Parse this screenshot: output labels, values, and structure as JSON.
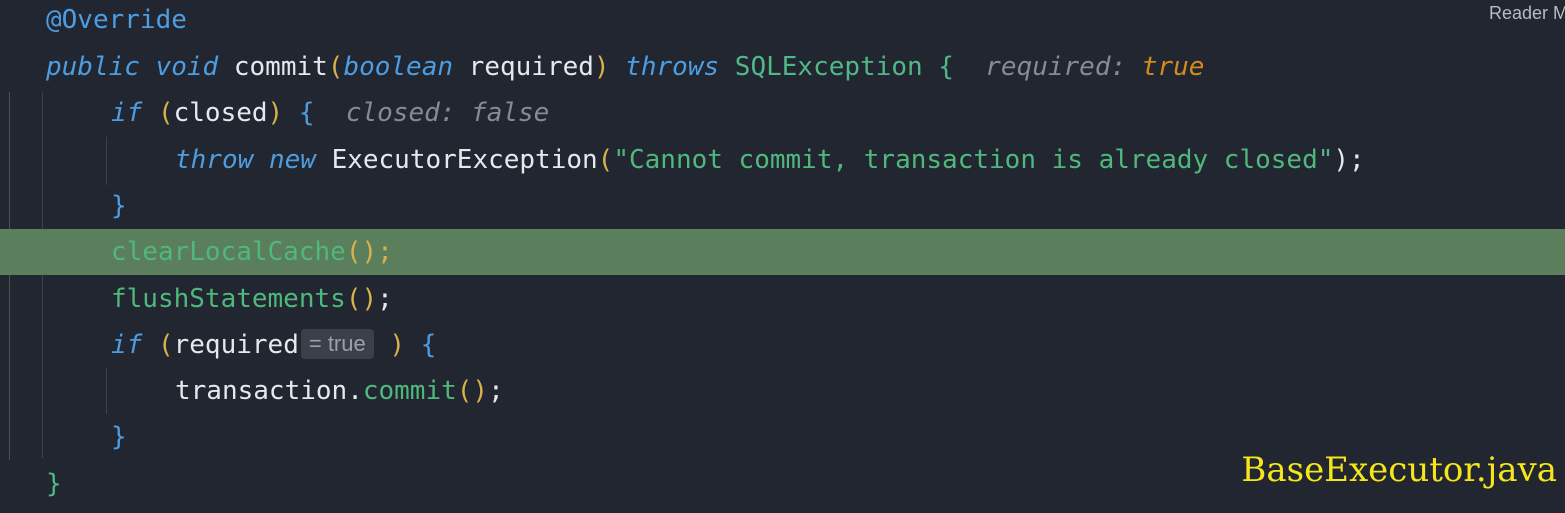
{
  "editor": {
    "reader_mode_label": "Reader M",
    "file_caption": "BaseExecutor.java",
    "lines": {
      "l1": {
        "annotation": "@Override"
      },
      "l2": {
        "mod": "public",
        "ret": "void",
        "name": "commit",
        "open_paren": "(",
        "param_type": "boolean",
        "param_name": "required",
        "close_paren": ")",
        "throws_kw": "throws",
        "exc": "SQLException",
        "brace": "{",
        "hint_label": "required:",
        "hint_value": "true"
      },
      "l3": {
        "kw": "if",
        "open_paren": "(",
        "var": "closed",
        "close_paren": ")",
        "brace": "{",
        "hint_label": "closed:",
        "hint_value": "false"
      },
      "l4": {
        "throw_kw": "throw",
        "new_kw": "new",
        "cls": "ExecutorException",
        "open_paren": "(",
        "str": "\"Cannot commit, transaction is already closed\"",
        "close": ");"
      },
      "l5": {
        "brace": "}"
      },
      "l6": {
        "call": "clearLocalCache",
        "parens": "()",
        "semi": ";"
      },
      "l7": {
        "call": "flushStatements",
        "parens": "()",
        "semi": ";"
      },
      "l8": {
        "kw": "if",
        "open_paren": "(",
        "var": "required",
        "chip": "= true",
        "close_paren": ")",
        "brace": "{"
      },
      "l9": {
        "obj": "transaction",
        "dot": ".",
        "call": "commit",
        "parens": "()",
        "semi": ";"
      },
      "l10": {
        "brace": "}"
      },
      "l11": {
        "brace": "}"
      }
    }
  }
}
